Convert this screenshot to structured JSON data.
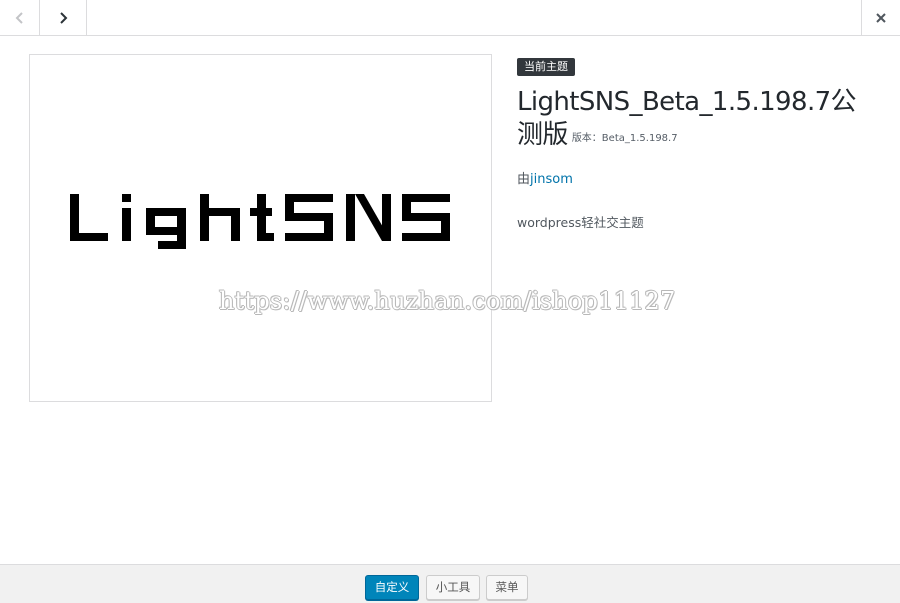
{
  "nav": {
    "prev_icon": "chevron-left-icon",
    "next_icon": "chevron-right-icon",
    "close_icon": "close-icon"
  },
  "screenshot": {
    "logo_text": "LightSNS"
  },
  "theme": {
    "badge": "当前主题",
    "name": "LightSNS_Beta_1.5.198.7公测版",
    "version": "版本：Beta_1.5.198.7",
    "author_prefix": "由",
    "author": "jinsom",
    "description": "wordpress轻社交主题"
  },
  "watermark": "https://www.huzhan.com/ishop11127",
  "actions": {
    "customize": "自定义",
    "widgets": "小工具",
    "menus": "菜单"
  },
  "colors": {
    "primary": "#0085ba",
    "link": "#0073aa",
    "badge_bg": "#32373c"
  }
}
